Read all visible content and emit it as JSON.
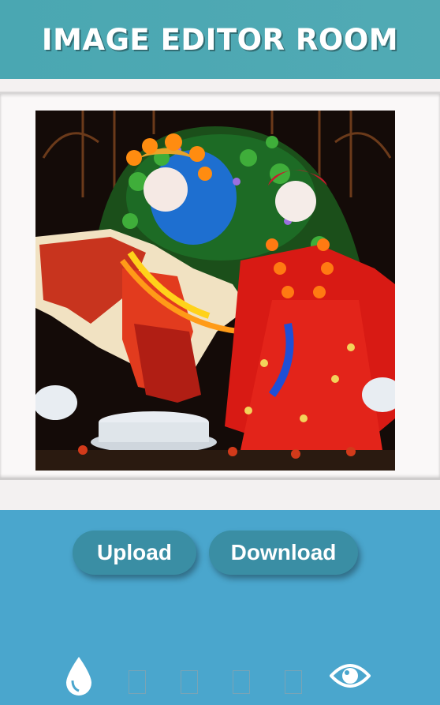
{
  "app": {
    "title": "IMAGE EDITOR ROOM"
  },
  "editor": {
    "image_subject": "Radha Krishna deity image"
  },
  "actions": {
    "upload_label": "Upload",
    "download_label": "Download"
  },
  "toolbar": {
    "tools": [
      {
        "icon": "drop-icon"
      },
      {
        "icon": "missing-glyph-icon"
      },
      {
        "icon": "missing-glyph-icon"
      },
      {
        "icon": "missing-glyph-icon"
      },
      {
        "icon": "missing-glyph-icon"
      },
      {
        "icon": "eye-icon"
      }
    ]
  },
  "colors": {
    "header": "#4aa7b2",
    "controls_bg": "#4aa6cd",
    "button": "#3a8ea4",
    "text_light": "#ffffff"
  }
}
